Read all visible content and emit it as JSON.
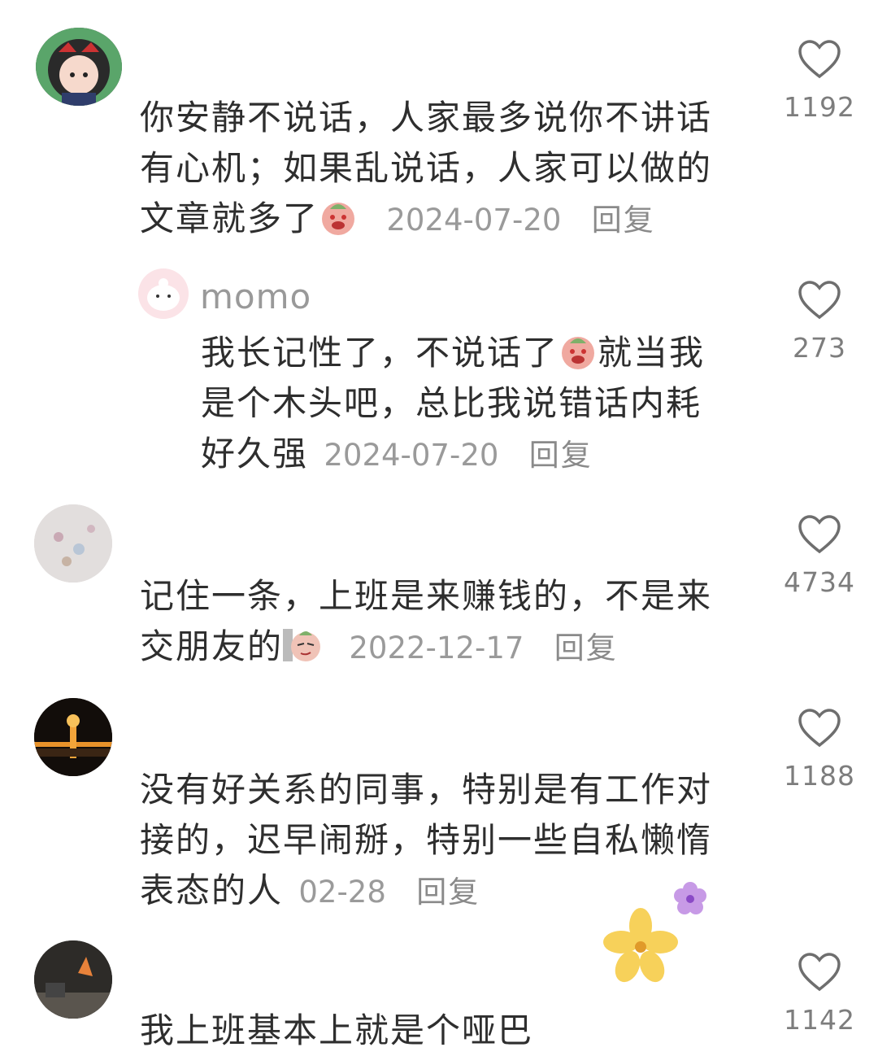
{
  "comments": [
    {
      "text": "你安静不说话，人家最多说你不讲话有心机；如果乱说话，人家可以做的文章就多了",
      "line1": "你安静不说话，人家最多说你不讲话",
      "line2": "有心机；如果乱说话，人家可以做的",
      "line3": "文章就多了",
      "emoji": "crying-face-emoji",
      "date": "2024-07-20",
      "reply_label": "回复",
      "likes": "1192"
    },
    {
      "username": "momo",
      "line1a": "我长记性了，不说话了",
      "line1b": "就当我",
      "line2": "是个木头吧，总比我说错话内耗",
      "line3": "好久强",
      "emoji": "crying-face-emoji",
      "date": "2024-07-20",
      "reply_label": "回复",
      "likes": "273"
    },
    {
      "line1": "记住一条，上班是来赚钱的，不是来",
      "line2": "交朋友的",
      "emoji": "smirk-face-emoji",
      "date": "2022-12-17",
      "reply_label": "回复",
      "likes": "4734"
    },
    {
      "line1": "没有好关系的同事，特别是有工作对",
      "line2": "接的，迟早闹掰，特别一些自私懒惰",
      "line3": "表态的人",
      "date": "02-28",
      "reply_label": "回复",
      "likes": "1188"
    },
    {
      "line1": "我上班基本上就是个哑巴",
      "likes": "1142"
    }
  ],
  "colors": {
    "text": "#2e2e2e",
    "meta": "#9a9a9a",
    "heart": "#6e6e6e"
  }
}
